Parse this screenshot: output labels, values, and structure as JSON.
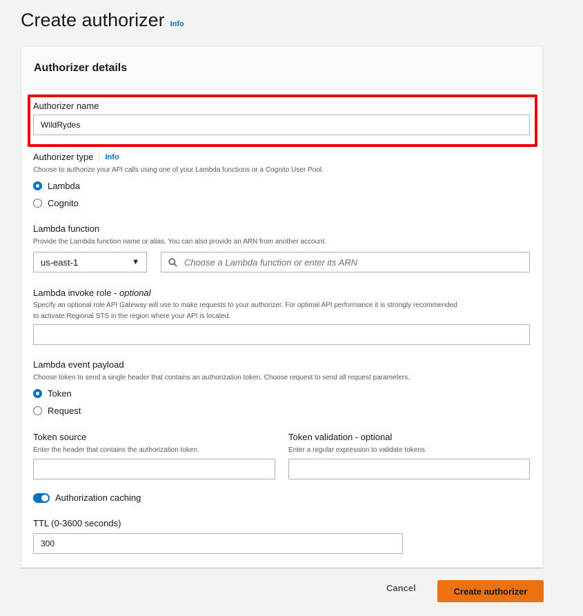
{
  "page": {
    "title": "Create authorizer",
    "info": "Info"
  },
  "panel": {
    "title": "Authorizer details"
  },
  "authorizer_name": {
    "label": "Authorizer name",
    "value": "WildRydes"
  },
  "authorizer_type": {
    "label": "Authorizer type",
    "info": "Info",
    "description": "Choose to authorize your API calls using one of your Lambda functions or a Cognito User Pool.",
    "options": [
      "Lambda",
      "Cognito"
    ],
    "selected": "Lambda"
  },
  "lambda_function": {
    "label": "Lambda function",
    "description": "Provide the Lambda function name or alias. You can also provide an ARN from another account.",
    "region": "us-east-1",
    "placeholder": "Choose a Lambda function or enter its ARN"
  },
  "invoke_role": {
    "label": "Lambda invoke role - ",
    "label_optional": "optional",
    "description_line1": "Specify an optional role API Gateway will use to make requests to your authorizer. For optimal API performance it is strongly recommended",
    "description_line2": "to activate Regional STS in the region where your API is located.",
    "value": ""
  },
  "event_payload": {
    "label": "Lambda event payload",
    "description": "Choose token to send a single header that contains an authorization token. Choose request to send all request parameters.",
    "options": [
      "Token",
      "Request"
    ],
    "selected": "Token"
  },
  "token_source": {
    "label": "Token source",
    "description": "Enter the header that contains the authorization token.",
    "value": ""
  },
  "token_validation": {
    "label": "Token validation - optional",
    "description": "Enter a regular expression to validate tokens.",
    "value": ""
  },
  "caching": {
    "label": "Authorization caching",
    "enabled": true
  },
  "ttl": {
    "label": "TTL (0-3600 seconds)",
    "value": "300"
  },
  "actions": {
    "cancel": "Cancel",
    "create": "Create authorizer"
  },
  "colors": {
    "accent": "#0073bb",
    "primary_button": "#ec7211",
    "highlight": "#e8000b"
  }
}
